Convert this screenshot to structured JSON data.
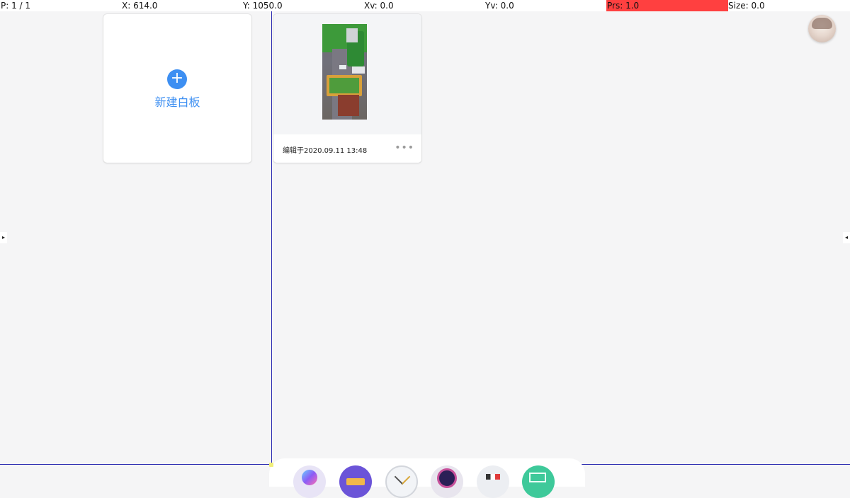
{
  "debug_bar": {
    "pointers": "P: 1 / 1",
    "x": "X: 614.0",
    "y": "Y: 1050.0",
    "xv": "Xv: 0.0",
    "yv": "Yv: 0.0",
    "prs": "Prs: 1.0",
    "size": "Size: 0.0",
    "prs_color": "#ff4040"
  },
  "new_board": {
    "icon": "plus-icon",
    "label": "新建白板",
    "accent": "#3d8ff2"
  },
  "boards": [
    {
      "thumbnail": "board-thumbnail",
      "edited_label": "编辑于2020.09.11 13:48",
      "more_icon": "•••"
    }
  ],
  "side_arrows": {
    "left": "▸",
    "right": "◂"
  },
  "dock": {
    "items": [
      "app-icon-1",
      "files-icon",
      "clock-icon",
      "camera-icon",
      "flag-icon",
      "whiteboard-icon"
    ]
  }
}
